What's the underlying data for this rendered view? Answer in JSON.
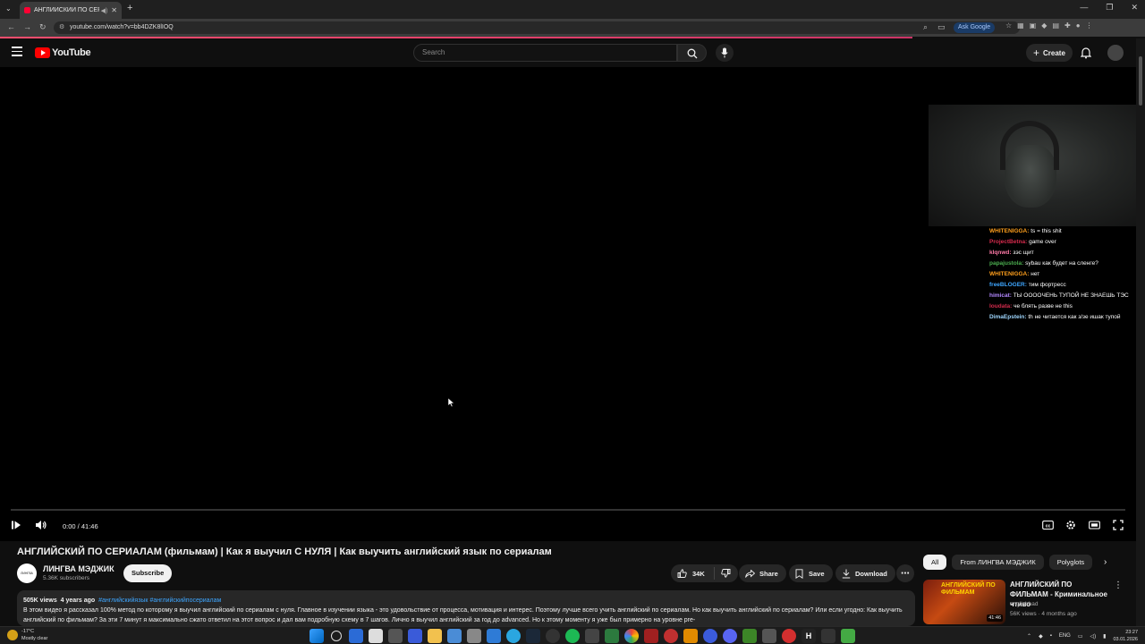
{
  "browser": {
    "tab_title": "АНГЛИЙСКИЙ ПО СЕРИА",
    "url": "youtube.com/watch?v=bb4DZK8lIOQ",
    "ask_google": "Ask Google"
  },
  "header": {
    "logo_text": "YouTube",
    "search_placeholder": "Search",
    "create_label": "Create"
  },
  "chat": [
    {
      "user": "WHITENIGGA:",
      "text": "ts = this shit",
      "color": "#ff9f1c"
    },
    {
      "user": "ProjectBetna:",
      "text": "game over",
      "color": "#d62b4d"
    },
    {
      "user": "klqnwd:",
      "text": "зэс щит",
      "color": "#ff7aa8"
    },
    {
      "user": "papajustola:",
      "text": "sybau как будет на сленге?",
      "color": "#4caf50"
    },
    {
      "user": "WHITENIGGA:",
      "text": "нет",
      "color": "#ff9f1c"
    },
    {
      "user": "freeBLOGER:",
      "text": "тим фортресс",
      "color": "#3ea6ff"
    },
    {
      "user": "himicat:",
      "text": "ТЫ ОООOЧЕНЬ ТУПОЙ НЕ ЗНАЕШЬ ТЭС",
      "color": "#b388ff"
    },
    {
      "user": "loudata:",
      "text": "че блять разве не this",
      "color": "#d62b4d"
    },
    {
      "user": "DimaEpstein:",
      "text": "th не читается как з/зе ишак тупой",
      "color": "#9fd7ff"
    }
  ],
  "player": {
    "time": "0:00 / 41:46",
    "progress": 0
  },
  "video": {
    "title": "АНГЛИЙСКИЙ ПО СЕРИАЛАМ (фильмам) | Как я выучил С НУЛЯ | Как выучить английский язык по сериалам",
    "channel": "ЛИНГВА МЭДЖИК",
    "channel_avatar_text": "ЛИНГВА МЭДЖИК",
    "subscribers": "5.36K subscribers",
    "subscribe_label": "Subscribe",
    "likes": "34K",
    "share_label": "Share",
    "save_label": "Save",
    "download_label": "Download",
    "views": "505K views",
    "age": "4 years ago",
    "tags": "#английскийязык #английскийпосериалам",
    "description": "В этом видео я рассказал 100% метод по которому я выучил английский по сериалам с нуля. Главное в изучении языка - это удовольствие от процесса, мотивация и интерес. Поэтому лучше всего учить английский по сериалам. Но как выучить английский по сериалам? Или если угодно: Как выучить английский по фильмам? За эти 7 минут я максимально сжато ответил на этот вопрос и дал вам подробную схему в 7 шагов. Лично я выучил английский за год до advanced. Но к этому моменту я уже был примерно на уровне pre-"
  },
  "rail": {
    "chips": [
      "All",
      "From ЛИНГВА МЭДЖИК",
      "Polyglots"
    ],
    "rec": {
      "title": "АНГЛИЙСКИЙ ПО ФИЛЬМАМ - Криминальное чтиво",
      "thumb_text": "АНГЛИЙСКИЙ ПО ФИЛЬМАМ",
      "channel": "englishbad",
      "meta": "56K views · 4 months ago",
      "duration": "41:46"
    }
  },
  "taskbar": {
    "temp": "-17°C",
    "weather": "Mostly clear",
    "lang": "ENG",
    "time": "23:27",
    "date": "03.01.2026"
  }
}
